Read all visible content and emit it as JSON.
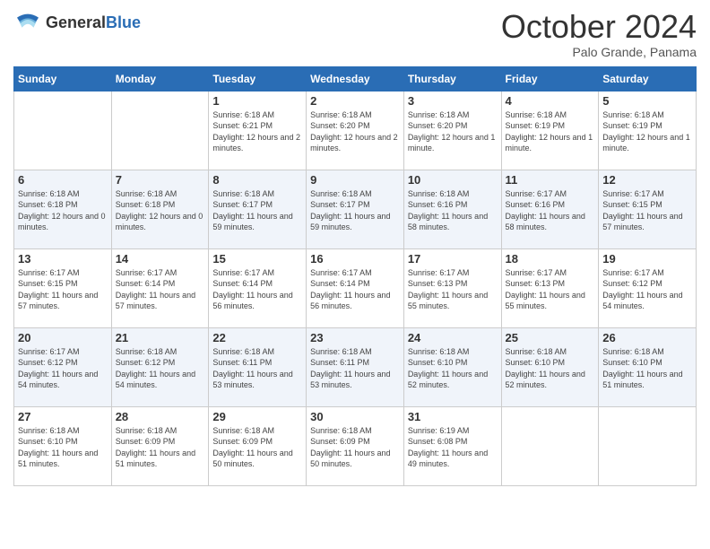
{
  "header": {
    "logo_general": "General",
    "logo_blue": "Blue",
    "month_title": "October 2024",
    "location": "Palo Grande, Panama"
  },
  "days_of_week": [
    "Sunday",
    "Monday",
    "Tuesday",
    "Wednesday",
    "Thursday",
    "Friday",
    "Saturday"
  ],
  "weeks": [
    [
      null,
      null,
      {
        "day": "1",
        "sunrise": "6:18 AM",
        "sunset": "6:21 PM",
        "daylight": "12 hours and 2 minutes."
      },
      {
        "day": "2",
        "sunrise": "6:18 AM",
        "sunset": "6:20 PM",
        "daylight": "12 hours and 2 minutes."
      },
      {
        "day": "3",
        "sunrise": "6:18 AM",
        "sunset": "6:20 PM",
        "daylight": "12 hours and 1 minute."
      },
      {
        "day": "4",
        "sunrise": "6:18 AM",
        "sunset": "6:19 PM",
        "daylight": "12 hours and 1 minute."
      },
      {
        "day": "5",
        "sunrise": "6:18 AM",
        "sunset": "6:19 PM",
        "daylight": "12 hours and 1 minute."
      }
    ],
    [
      {
        "day": "6",
        "sunrise": "6:18 AM",
        "sunset": "6:18 PM",
        "daylight": "12 hours and 0 minutes."
      },
      {
        "day": "7",
        "sunrise": "6:18 AM",
        "sunset": "6:18 PM",
        "daylight": "12 hours and 0 minutes."
      },
      {
        "day": "8",
        "sunrise": "6:18 AM",
        "sunset": "6:17 PM",
        "daylight": "11 hours and 59 minutes."
      },
      {
        "day": "9",
        "sunrise": "6:18 AM",
        "sunset": "6:17 PM",
        "daylight": "11 hours and 59 minutes."
      },
      {
        "day": "10",
        "sunrise": "6:18 AM",
        "sunset": "6:16 PM",
        "daylight": "11 hours and 58 minutes."
      },
      {
        "day": "11",
        "sunrise": "6:17 AM",
        "sunset": "6:16 PM",
        "daylight": "11 hours and 58 minutes."
      },
      {
        "day": "12",
        "sunrise": "6:17 AM",
        "sunset": "6:15 PM",
        "daylight": "11 hours and 57 minutes."
      }
    ],
    [
      {
        "day": "13",
        "sunrise": "6:17 AM",
        "sunset": "6:15 PM",
        "daylight": "11 hours and 57 minutes."
      },
      {
        "day": "14",
        "sunrise": "6:17 AM",
        "sunset": "6:14 PM",
        "daylight": "11 hours and 57 minutes."
      },
      {
        "day": "15",
        "sunrise": "6:17 AM",
        "sunset": "6:14 PM",
        "daylight": "11 hours and 56 minutes."
      },
      {
        "day": "16",
        "sunrise": "6:17 AM",
        "sunset": "6:14 PM",
        "daylight": "11 hours and 56 minutes."
      },
      {
        "day": "17",
        "sunrise": "6:17 AM",
        "sunset": "6:13 PM",
        "daylight": "11 hours and 55 minutes."
      },
      {
        "day": "18",
        "sunrise": "6:17 AM",
        "sunset": "6:13 PM",
        "daylight": "11 hours and 55 minutes."
      },
      {
        "day": "19",
        "sunrise": "6:17 AM",
        "sunset": "6:12 PM",
        "daylight": "11 hours and 54 minutes."
      }
    ],
    [
      {
        "day": "20",
        "sunrise": "6:17 AM",
        "sunset": "6:12 PM",
        "daylight": "11 hours and 54 minutes."
      },
      {
        "day": "21",
        "sunrise": "6:18 AM",
        "sunset": "6:12 PM",
        "daylight": "11 hours and 54 minutes."
      },
      {
        "day": "22",
        "sunrise": "6:18 AM",
        "sunset": "6:11 PM",
        "daylight": "11 hours and 53 minutes."
      },
      {
        "day": "23",
        "sunrise": "6:18 AM",
        "sunset": "6:11 PM",
        "daylight": "11 hours and 53 minutes."
      },
      {
        "day": "24",
        "sunrise": "6:18 AM",
        "sunset": "6:10 PM",
        "daylight": "11 hours and 52 minutes."
      },
      {
        "day": "25",
        "sunrise": "6:18 AM",
        "sunset": "6:10 PM",
        "daylight": "11 hours and 52 minutes."
      },
      {
        "day": "26",
        "sunrise": "6:18 AM",
        "sunset": "6:10 PM",
        "daylight": "11 hours and 51 minutes."
      }
    ],
    [
      {
        "day": "27",
        "sunrise": "6:18 AM",
        "sunset": "6:10 PM",
        "daylight": "11 hours and 51 minutes."
      },
      {
        "day": "28",
        "sunrise": "6:18 AM",
        "sunset": "6:09 PM",
        "daylight": "11 hours and 51 minutes."
      },
      {
        "day": "29",
        "sunrise": "6:18 AM",
        "sunset": "6:09 PM",
        "daylight": "11 hours and 50 minutes."
      },
      {
        "day": "30",
        "sunrise": "6:18 AM",
        "sunset": "6:09 PM",
        "daylight": "11 hours and 50 minutes."
      },
      {
        "day": "31",
        "sunrise": "6:19 AM",
        "sunset": "6:08 PM",
        "daylight": "11 hours and 49 minutes."
      },
      null,
      null
    ]
  ],
  "labels": {
    "sunrise": "Sunrise:",
    "sunset": "Sunset:",
    "daylight": "Daylight:"
  }
}
